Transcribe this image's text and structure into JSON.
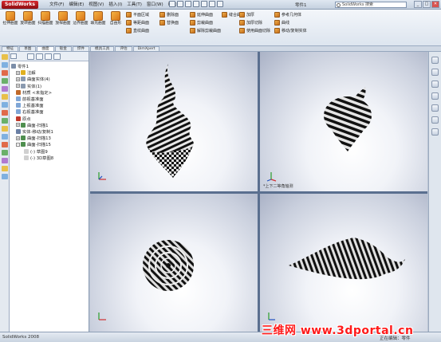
{
  "app": {
    "logo_text": "SolidWorks",
    "window_title": "零件1"
  },
  "menu": [
    "文件(F)",
    "编辑(E)",
    "视图(V)",
    "插入(I)",
    "工具(T)",
    "窗口(W)",
    "帮助(H)"
  ],
  "search": {
    "placeholder": "SolidWorks 搜索"
  },
  "window_controls": [
    "_",
    "□",
    "✕"
  ],
  "commands": {
    "big": [
      {
        "label": "拉伸曲面",
        "icon": "extrude-surface-icon"
      },
      {
        "label": "旋转曲面",
        "icon": "revolve-surface-icon"
      },
      {
        "label": "扫描曲面",
        "icon": "sweep-surface-icon"
      },
      {
        "label": "放样曲面",
        "icon": "loft-surface-icon"
      },
      {
        "label": "边界曲面",
        "icon": "boundary-surface-icon"
      },
      {
        "label": "填充曲面",
        "icon": "fill-surface-icon"
      },
      {
        "label": "自由形",
        "icon": "freeform-icon"
      }
    ],
    "small": [
      [
        "平面区域",
        "等距曲面",
        "直纹曲面"
      ],
      [
        "删除面",
        "替换面"
      ],
      [
        "延伸曲面",
        "剪裁曲面",
        "解除剪裁曲面"
      ],
      [
        "缝合曲面"
      ],
      [
        "加厚",
        "加厚切除",
        "使用曲面切除"
      ],
      [
        "参考几何体",
        "曲线",
        "移动/复制实体"
      ]
    ]
  },
  "tabs": [
    "特征",
    "草图",
    "曲面",
    "钣金",
    "焊件",
    "模具工具",
    "评估",
    "DimXpert"
  ],
  "active_tab": 2,
  "tree": [
    {
      "label": "零件1",
      "exp": "",
      "color": "#7c8ea9"
    },
    {
      "label": "注解",
      "exp": "+",
      "color": "#e0b020"
    },
    {
      "label": "曲面实体(4)",
      "exp": "+",
      "color": "#8a9ab0"
    },
    {
      "label": "实体(1)",
      "exp": "+",
      "color": "#8a9ab0"
    },
    {
      "label": "材质 <未指定>",
      "exp": "",
      "color": "#c0692a"
    },
    {
      "label": "前视基准面",
      "exp": "",
      "color": "#7fa6d6"
    },
    {
      "label": "上视基准面",
      "exp": "",
      "color": "#7fa6d6"
    },
    {
      "label": "右视基准面",
      "exp": "",
      "color": "#7fa6d6"
    },
    {
      "label": "原点",
      "exp": "",
      "color": "#c0392b"
    },
    {
      "label": "曲面-扫描1",
      "exp": "+",
      "color": "#4f8f4f"
    },
    {
      "label": "实体-移动/复制1",
      "exp": "",
      "color": "#6a7fa5"
    },
    {
      "label": "曲面-扫描13",
      "exp": "+",
      "color": "#4f8f4f"
    },
    {
      "label": "曲面-扫描15",
      "exp": "-",
      "color": "#4f8f4f"
    },
    {
      "label": "(-) 草图9",
      "exp": "",
      "color": "#d0d0d0"
    },
    {
      "label": "(-) 3D草图8",
      "exp": "",
      "color": "#d0d0d0"
    }
  ],
  "viewports": [
    {
      "label": ""
    },
    {
      "label": "*上下二等角轴测"
    },
    {
      "label": ""
    },
    {
      "label": ""
    }
  ],
  "status": {
    "left": "SolidWorks 2008",
    "right": "正在编辑：零件"
  },
  "watermark": "三维网 www.3dportal.cn"
}
